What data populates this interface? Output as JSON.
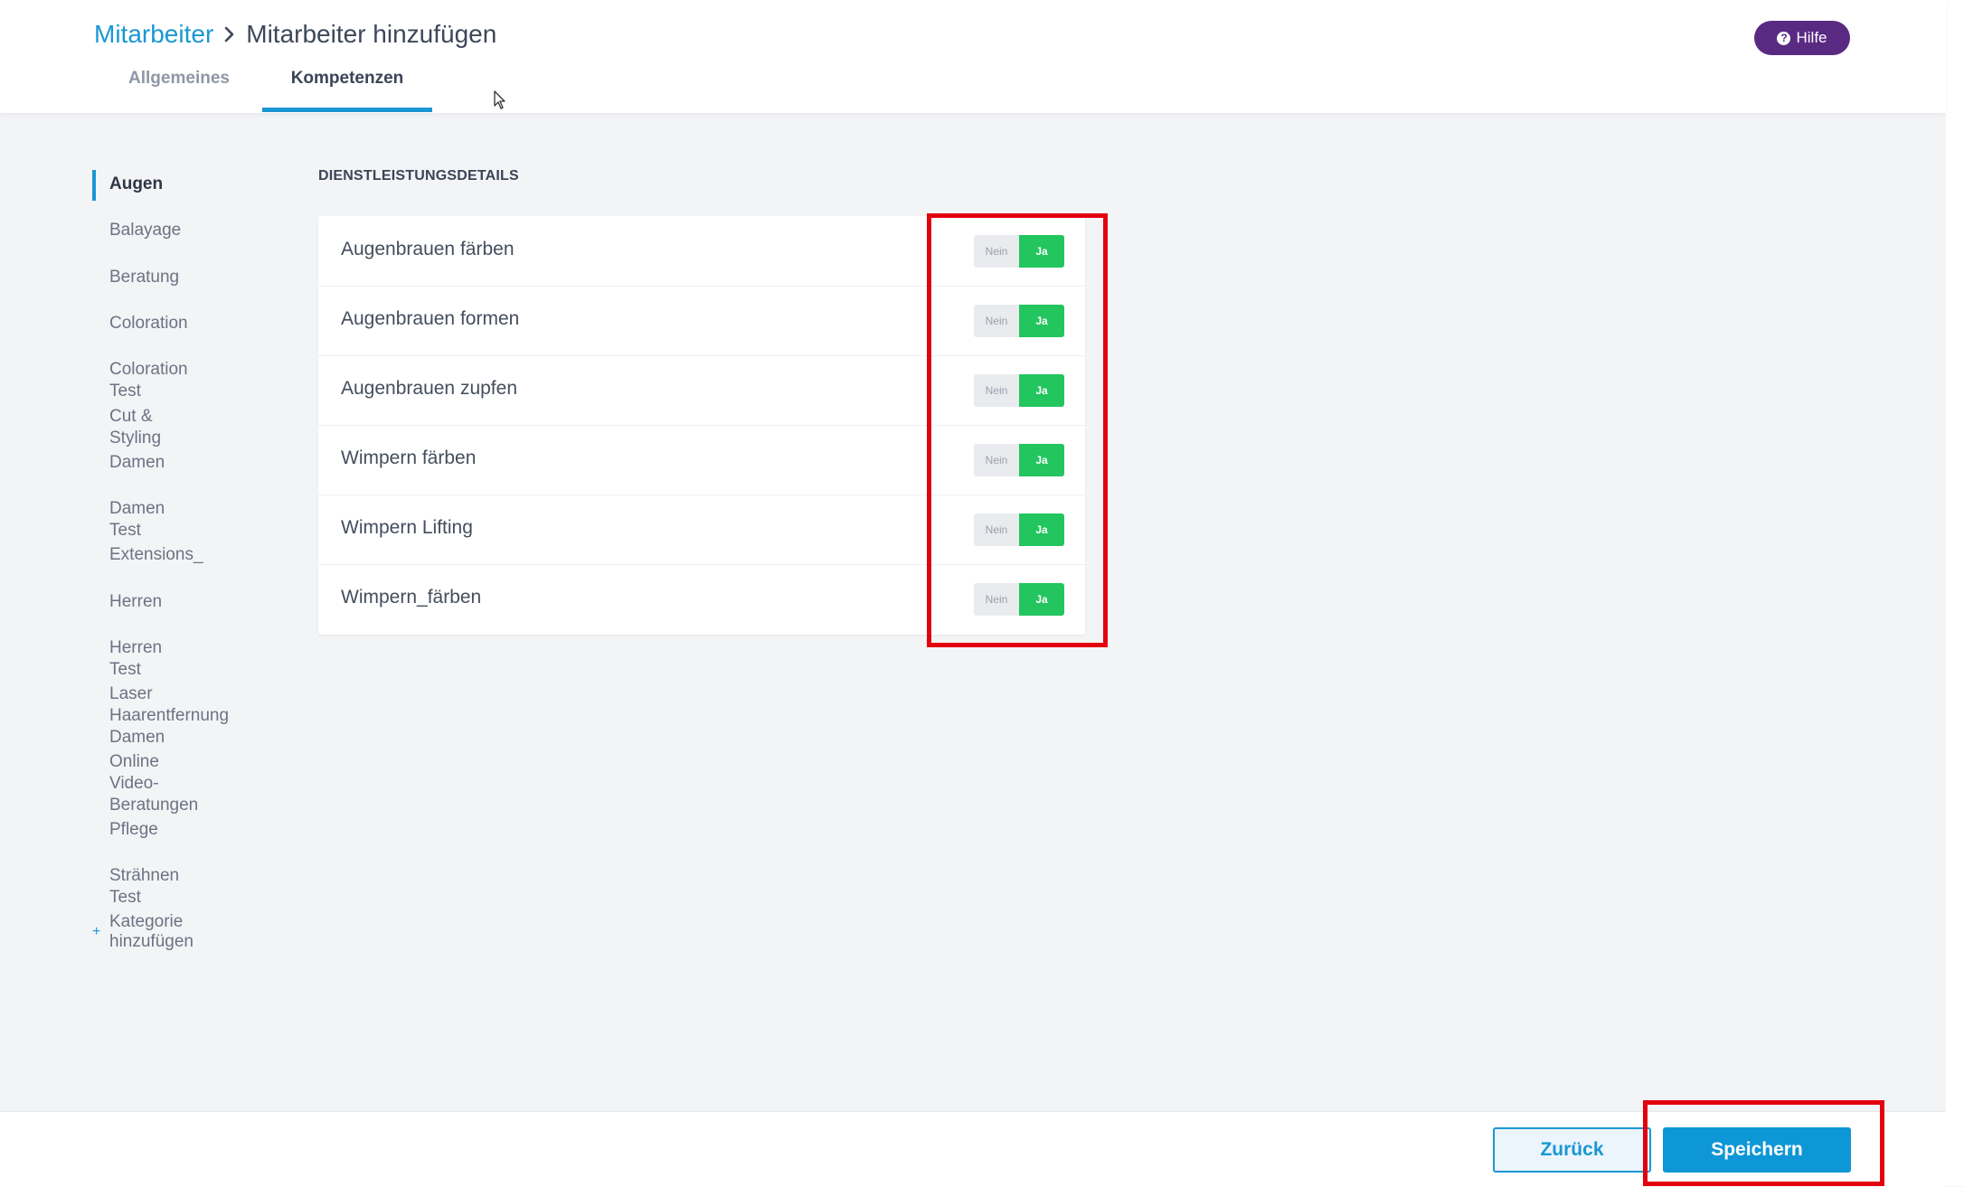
{
  "header": {
    "breadcrumb": {
      "parent": "Mitarbeiter",
      "current": "Mitarbeiter hinzufügen"
    },
    "help_label": "Hilfe",
    "tabs": [
      {
        "label": "Allgemeines",
        "active": false
      },
      {
        "label": "Kompetenzen",
        "active": true
      }
    ]
  },
  "sidebar": {
    "items": [
      {
        "label": "Augen",
        "active": true
      },
      {
        "label": "Balayage"
      },
      {
        "label": "Beratung"
      },
      {
        "label": "Coloration"
      },
      {
        "label": "Coloration Test"
      },
      {
        "label": "Cut & Styling"
      },
      {
        "label": "Damen"
      },
      {
        "label": "Damen Test"
      },
      {
        "label": "Extensions_"
      },
      {
        "label": "Herren"
      },
      {
        "label": "Herren Test"
      },
      {
        "label": "Laser Haarentfernung",
        "label2": "Damen"
      },
      {
        "label": "Online Video-",
        "label2": "Beratungen"
      },
      {
        "label": "Pflege"
      },
      {
        "label": "Strähnen Test"
      }
    ],
    "add_label": "Kategorie hinzufügen"
  },
  "section": {
    "title": "DIENSTLEISTUNGSDETAILS",
    "toggle_off_label": "Nein",
    "toggle_on_label": "Ja",
    "services": [
      {
        "name": "Augenbrauen färben",
        "enabled": true
      },
      {
        "name": "Augenbrauen formen",
        "enabled": true
      },
      {
        "name": "Augenbrauen zupfen",
        "enabled": true
      },
      {
        "name": "Wimpern färben",
        "enabled": true
      },
      {
        "name": "Wimpern Lifting",
        "enabled": true
      },
      {
        "name": "Wimpern_färben",
        "enabled": true
      }
    ]
  },
  "footer": {
    "back_label": "Zurück",
    "save_label": "Speichern"
  },
  "colors": {
    "accent": "#1a97d4",
    "toggle_on": "#22c55e",
    "help_button": "#5a2a83",
    "highlight": "#e3000f"
  }
}
